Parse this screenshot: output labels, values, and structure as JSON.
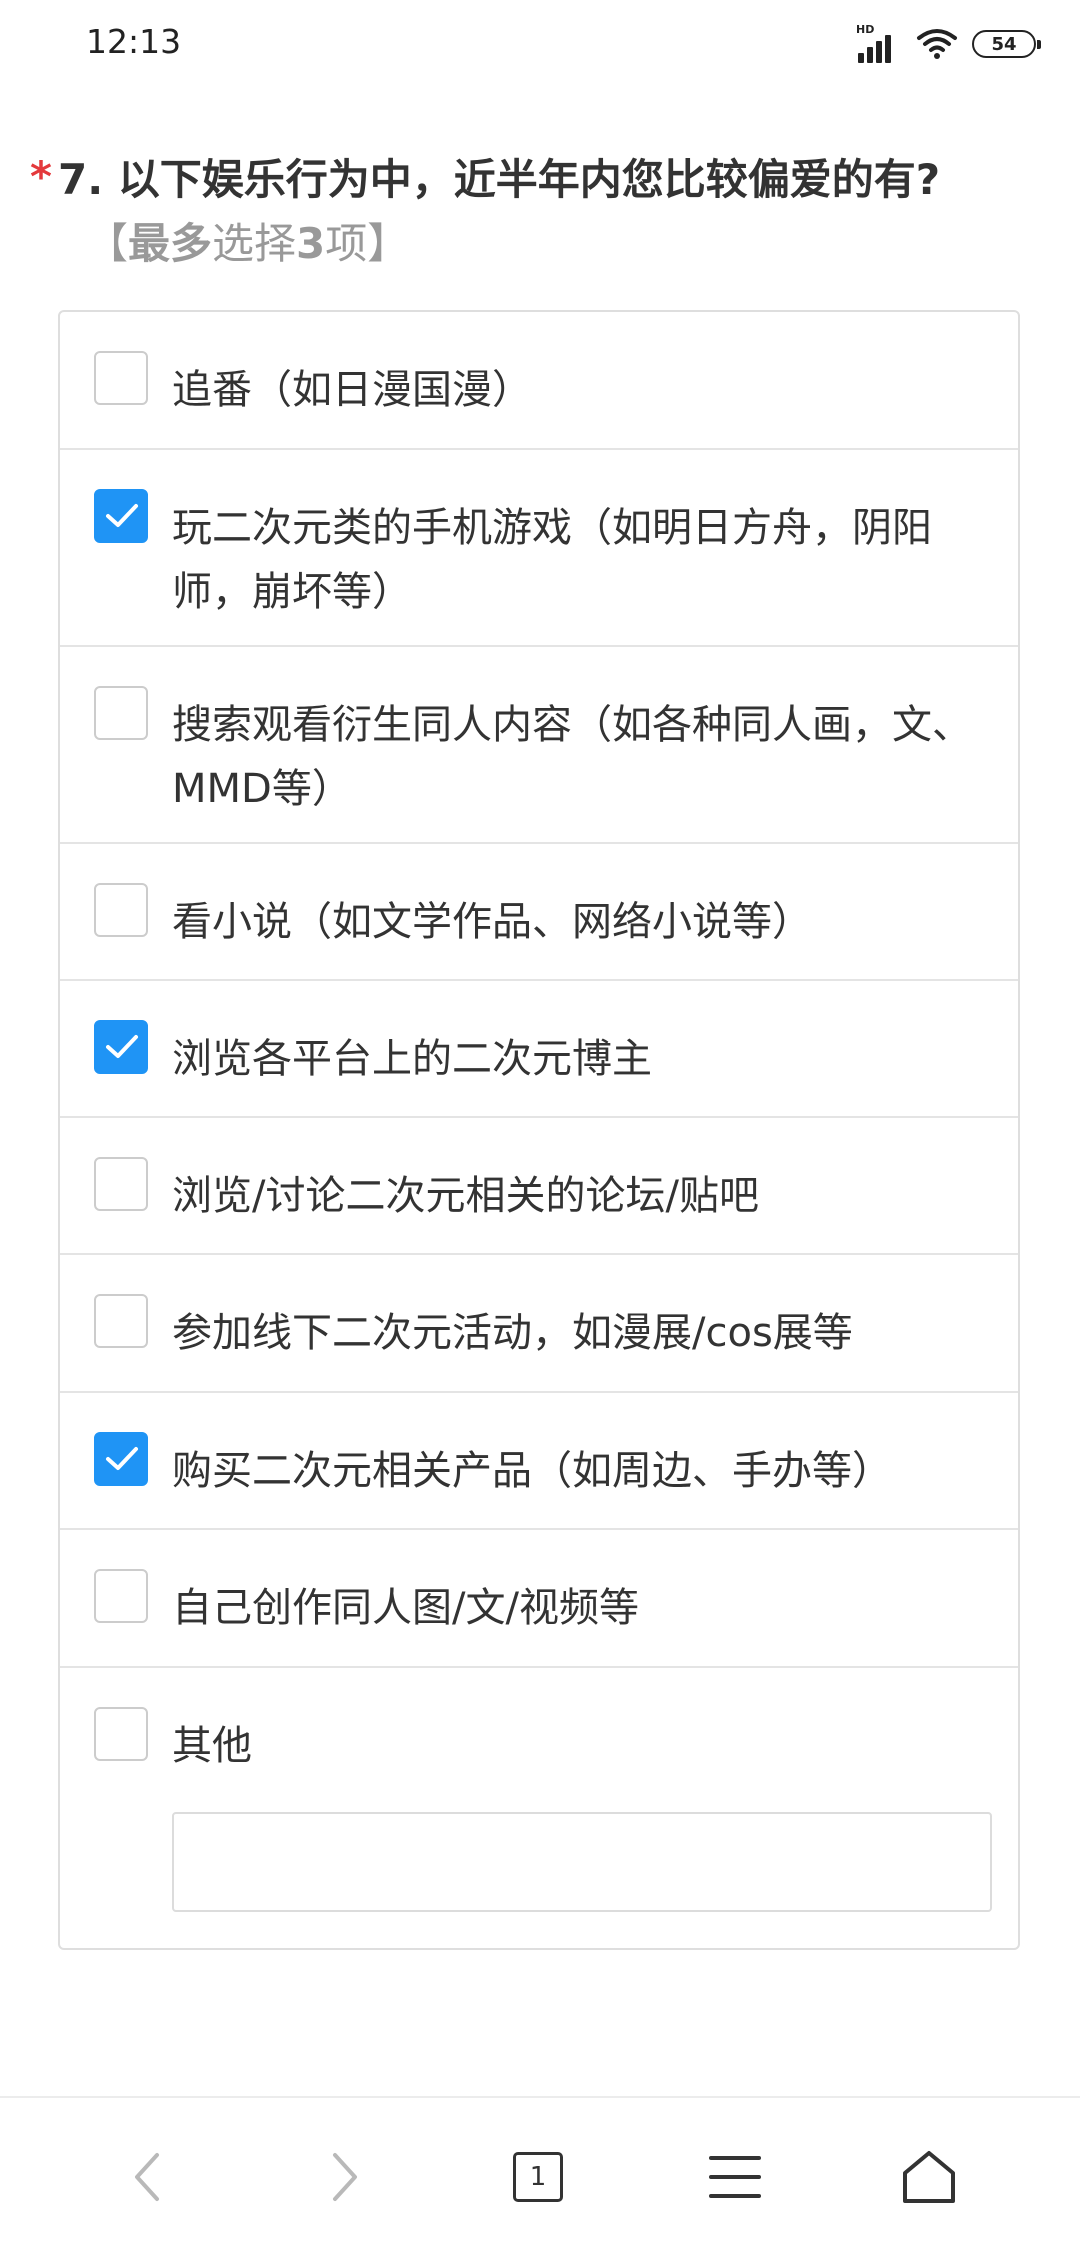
{
  "status_bar": {
    "time": "12:13",
    "hd_label": "HD",
    "battery": "54"
  },
  "question": {
    "required_mark": "*",
    "title": "7. 以下娱乐行为中，近半年内您比较偏爱的有?",
    "hint_open": "【",
    "hint_bold_1": "最多",
    "hint_mid": "选择",
    "hint_bold_2": "3",
    "hint_end": "项】"
  },
  "options": [
    {
      "label": "追番（如日漫国漫）",
      "checked": false
    },
    {
      "label": "玩二次元类的手机游戏（如明日方舟，阴阳师，崩坏等）",
      "checked": true
    },
    {
      "label": "搜索观看衍生同人内容（如各种同人画，文、MMD等）",
      "checked": false
    },
    {
      "label": "看小说（如文学作品、网络小说等）",
      "checked": false
    },
    {
      "label": "浏览各平台上的二次元博主",
      "checked": true
    },
    {
      "label": "浏览/讨论二次元相关的论坛/贴吧",
      "checked": false
    },
    {
      "label": "参加线下二次元活动，如漫展/cos展等",
      "checked": false
    },
    {
      "label": "购买二次元相关产品（如周边、手办等）",
      "checked": true
    },
    {
      "label": "自己创作同人图/文/视频等",
      "checked": false
    },
    {
      "label": "其他",
      "checked": false
    }
  ],
  "other_input": {
    "value": "",
    "placeholder": ""
  },
  "bottom_nav": {
    "tab_count": "1",
    "icons": [
      "back-arrow-icon",
      "forward-arrow-icon",
      "tabs-icon",
      "menu-icon",
      "home-icon"
    ]
  },
  "colors": {
    "accent": "#1f94f5",
    "required": "#e4393c",
    "hint": "#999999",
    "text": "#333333"
  }
}
